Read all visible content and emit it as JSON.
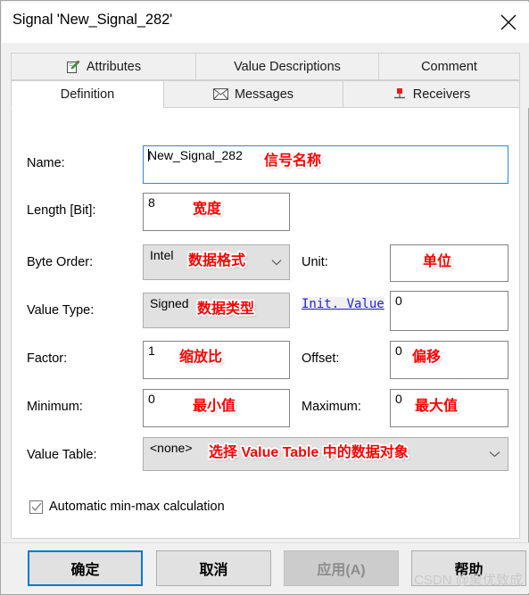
{
  "window": {
    "title": "Signal 'New_Signal_282'",
    "close_icon": "close-icon"
  },
  "tabs": {
    "row1": [
      {
        "label": "Attributes",
        "icon": "pencil-notepad-icon",
        "selected": false
      },
      {
        "label": "Value Descriptions",
        "icon": "",
        "selected": false
      },
      {
        "label": "Comment",
        "icon": "",
        "selected": false
      }
    ],
    "row2": [
      {
        "label": "Definition",
        "icon": "",
        "selected": true
      },
      {
        "label": "Messages",
        "icon": "envelope-icon",
        "selected": false
      },
      {
        "label": "Receivers",
        "icon": "node-pin-icon",
        "selected": false
      }
    ]
  },
  "form": {
    "name": {
      "label": "Name:",
      "value": "New_Signal_282",
      "annotation": "信号名称"
    },
    "length": {
      "label": "Length [Bit]:",
      "value": "8",
      "annotation": "宽度"
    },
    "byte_order": {
      "label": "Byte Order:",
      "value": "Intel",
      "annotation": "数据格式"
    },
    "unit": {
      "label": "Unit:",
      "value": "",
      "annotation": "单位"
    },
    "value_type": {
      "label": "Value Type:",
      "value": "Signed",
      "annotation": "数据类型"
    },
    "init_value": {
      "label": "Init. Value",
      "value": "0"
    },
    "factor": {
      "label": "Factor:",
      "value": "1",
      "annotation": "缩放比"
    },
    "offset": {
      "label": "Offset:",
      "value": "0",
      "annotation": "偏移"
    },
    "minimum": {
      "label": "Minimum:",
      "value": "0",
      "annotation": "最小值"
    },
    "maximum": {
      "label": "Maximum:",
      "value": "0",
      "annotation": "最大值"
    },
    "value_table": {
      "label": "Value Table:",
      "value": "<none>",
      "annotation": "选择 Value Table 中的数据对象"
    },
    "auto_minmax": {
      "label": "Automatic min-max calculation",
      "checked": true
    }
  },
  "buttons": {
    "ok": "确定",
    "cancel": "取消",
    "apply": "应用(A)",
    "help": "帮助"
  },
  "watermark": "CSDN @聚优致成",
  "colors": {
    "accent": "#0078d7",
    "annotation": "#ff0000",
    "link": "#2222dd",
    "window_bg": "#f0f0f0"
  }
}
